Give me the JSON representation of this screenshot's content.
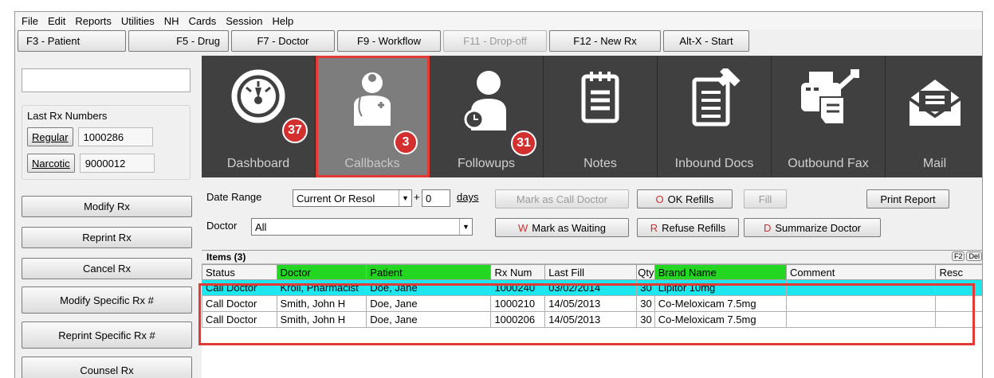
{
  "menu": [
    "File",
    "Edit",
    "Reports",
    "Utilities",
    "NH",
    "Cards",
    "Session",
    "Help"
  ],
  "toolbar": [
    {
      "label": "F3 - Patient",
      "disabled": false
    },
    {
      "label": "F5 - Drug",
      "disabled": false
    },
    {
      "label": "F7 - Doctor",
      "disabled": false
    },
    {
      "label": "F9 - Workflow",
      "disabled": false
    },
    {
      "label": "F11 - Drop-off",
      "disabled": true
    },
    {
      "label": "F12 - New Rx",
      "disabled": false
    },
    {
      "label": "Alt-X - Start",
      "disabled": false
    }
  ],
  "last_rx": {
    "title": "Last Rx Numbers",
    "regular_label": "Regular",
    "regular_value": "1000286",
    "narcotic_label": "Narcotic",
    "narcotic_value": "9000012"
  },
  "left_buttons": [
    "Modify Rx",
    "Reprint Rx",
    "Cancel Rx",
    "Modify Specific Rx #",
    "Reprint Specific Rx #",
    "Counsel Rx"
  ],
  "tiles": [
    {
      "label": "Dashboard",
      "icon": "gauge-icon",
      "badge": "37"
    },
    {
      "label": "Callbacks",
      "icon": "doctor-icon",
      "badge": "3"
    },
    {
      "label": "Followups",
      "icon": "person-clock-icon",
      "badge": "31"
    },
    {
      "label": "Notes",
      "icon": "notepad-icon",
      "badge": ""
    },
    {
      "label": "Inbound Docs",
      "icon": "inbound-doc-icon",
      "badge": ""
    },
    {
      "label": "Outbound Fax",
      "icon": "fax-icon",
      "badge": ""
    },
    {
      "label": "Mail",
      "icon": "mail-icon",
      "badge": ""
    }
  ],
  "filters": {
    "date_range_label": "Date Range",
    "date_range_value": "Current Or Resol",
    "plus_label": "+",
    "days_value": "0",
    "days_label": "days",
    "doctor_label": "Doctor",
    "doctor_value": "All"
  },
  "actions": {
    "mark_call_doctor": "Mark as Call Doctor",
    "ok_refills_key": "O",
    "ok_refills": "OK Refills",
    "fill": "Fill",
    "print_report": "Print Report",
    "mark_waiting_key": "W",
    "mark_waiting": "Mark as Waiting",
    "refuse_refills_key": "R",
    "refuse_refills": "Refuse Refills",
    "summarize_key": "D",
    "summarize": "Summarize Doctor"
  },
  "grid": {
    "items_label": "Items (3)",
    "keys": [
      "F2",
      "Del"
    ],
    "columns": [
      "Status",
      "Doctor",
      "Patient",
      "Rx Num",
      "Last Fill",
      "Qty",
      "Brand Name",
      "Comment",
      "Resc"
    ],
    "rows": [
      [
        "Call Doctor",
        "Kroll, Pharmacist",
        "Doe, Jane",
        "1000240",
        "03/02/2014",
        "30",
        "Lipitor 10mg",
        "",
        ""
      ],
      [
        "Call Doctor",
        "Smith, John H",
        "Doe, Jane",
        "1000210",
        "14/05/2013",
        "30",
        "Co-Meloxicam 7.5mg",
        "",
        ""
      ],
      [
        "Call Doctor",
        "Smith, John H",
        "Doe, Jane",
        "1000206",
        "14/05/2013",
        "30",
        "Co-Meloxicam 7.5mg",
        "",
        ""
      ]
    ]
  },
  "colors": {
    "accent_highlight": "#e53935",
    "selected_row": "#1ee6ee",
    "header_green": "#22d622",
    "badge": "#d32f2f"
  }
}
